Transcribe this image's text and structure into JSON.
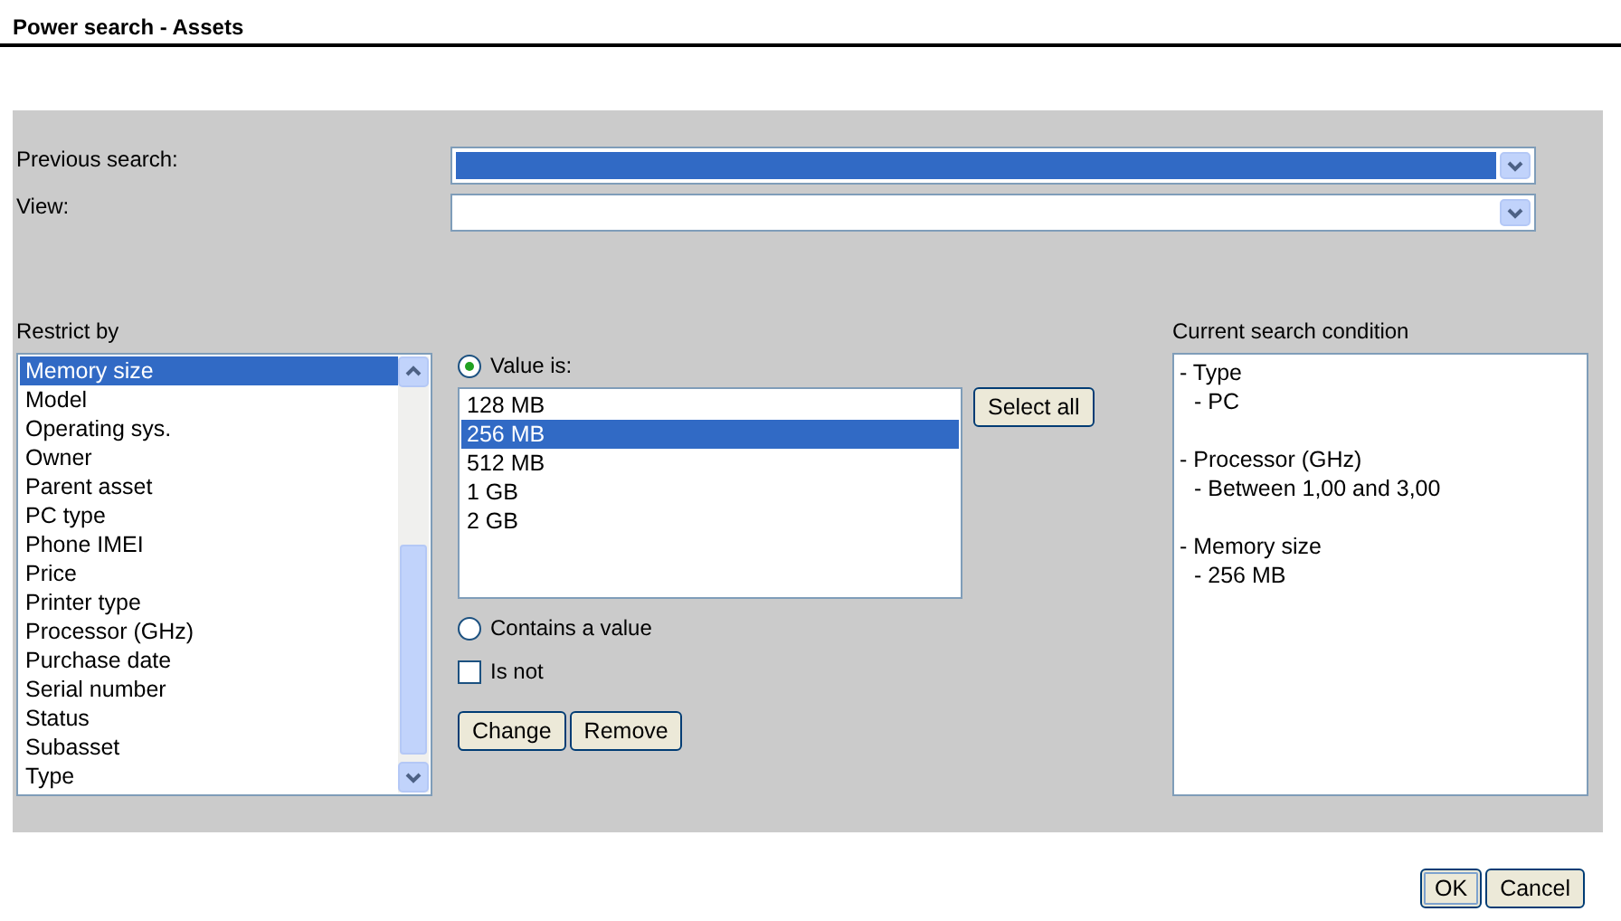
{
  "window": {
    "title": "Power search - Assets"
  },
  "previous_search": {
    "label": "Previous search:",
    "focused": true
  },
  "view": {
    "label": "View:",
    "focused": false
  },
  "restrict_by": {
    "label": "Restrict by",
    "items": [
      {
        "label": "Memory size",
        "selected": true
      },
      {
        "label": "Model",
        "selected": false
      },
      {
        "label": "Operating sys.",
        "selected": false
      },
      {
        "label": "Owner",
        "selected": false
      },
      {
        "label": "Parent asset",
        "selected": false
      },
      {
        "label": "PC type",
        "selected": false
      },
      {
        "label": "Phone IMEI",
        "selected": false
      },
      {
        "label": "Price",
        "selected": false
      },
      {
        "label": "Printer type",
        "selected": false
      },
      {
        "label": "Processor (GHz)",
        "selected": false
      },
      {
        "label": "Purchase date",
        "selected": false
      },
      {
        "label": "Serial number",
        "selected": false
      },
      {
        "label": "Status",
        "selected": false
      },
      {
        "label": "Subasset",
        "selected": false
      },
      {
        "label": "Type",
        "selected": false
      }
    ]
  },
  "value_is": {
    "label": "Value is:",
    "selected": true,
    "values": [
      {
        "label": "128 MB",
        "selected": false
      },
      {
        "label": "256 MB",
        "selected": true
      },
      {
        "label": "512 MB",
        "selected": false
      },
      {
        "label": "1 GB",
        "selected": false
      },
      {
        "label": "2 GB",
        "selected": false
      }
    ],
    "select_all": "Select all"
  },
  "contains_value": {
    "label": "Contains a value",
    "selected": false
  },
  "is_not": {
    "label": "Is not",
    "checked": false
  },
  "actions": [
    "Change",
    "Remove"
  ],
  "current_condition": {
    "label": "Current search condition",
    "items": [
      {
        "label": "- Type",
        "children": [
          {
            "label": "- PC"
          }
        ]
      },
      {
        "label": "- Processor (GHz)",
        "children": [
          {
            "label": "- Between 1,00 and 3,00"
          }
        ]
      },
      {
        "label": "- Memory size",
        "children": [
          {
            "label": "- 256 MB"
          }
        ]
      }
    ]
  },
  "buttons": [
    {
      "label": "OK",
      "default": true
    },
    {
      "label": "Cancel",
      "default": false
    }
  ]
}
